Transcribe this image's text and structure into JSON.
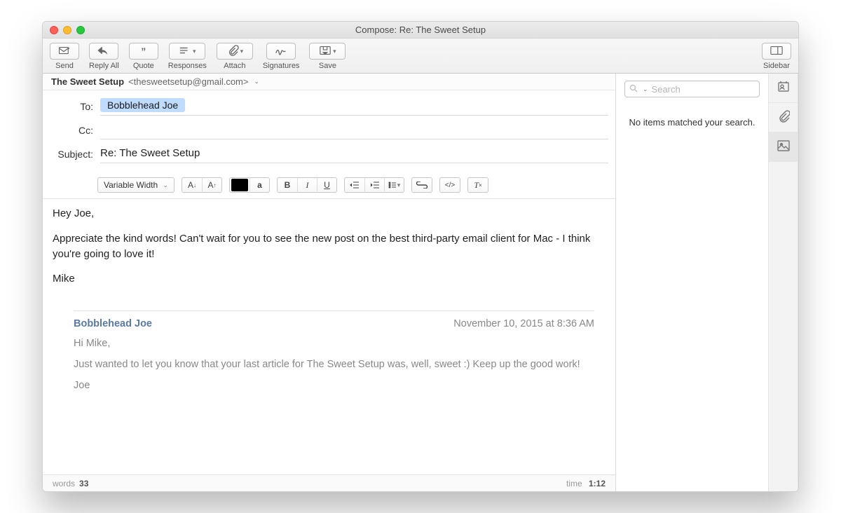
{
  "window": {
    "title": "Compose: Re: The Sweet Setup"
  },
  "toolbar": {
    "send": "Send",
    "reply_all": "Reply All",
    "quote": "Quote",
    "responses": "Responses",
    "attach": "Attach",
    "signatures": "Signatures",
    "save": "Save",
    "sidebar": "Sidebar"
  },
  "from": {
    "name": "The Sweet Setup",
    "address": "<thesweetsetup@gmail.com>"
  },
  "headers": {
    "to_label": "To:",
    "to_token": "Bobblehead Joe",
    "cc_label": "Cc:",
    "subject_label": "Subject:",
    "subject_value": "Re: The Sweet Setup"
  },
  "format": {
    "font_select": "Variable Width"
  },
  "body": {
    "p1": "Hey Joe,",
    "p2": "Appreciate the kind words! Can't wait for you to see the new post on the best third-party email client for Mac - I think you're going to love it!",
    "p3": "Mike"
  },
  "quoted": {
    "name": "Bobblehead Joe",
    "date": "November 10, 2015 at 8:36 AM",
    "p1": "Hi Mike,",
    "p2": "Just wanted to let you know that your last article for The Sweet Setup was, well, sweet :) Keep up the good work!",
    "p3": "Joe"
  },
  "status": {
    "words_label": "words",
    "words_count": "33",
    "time_label": "time",
    "time_value": "1:12"
  },
  "sidebar": {
    "search_placeholder": "Search",
    "empty": "No items matched your search."
  }
}
